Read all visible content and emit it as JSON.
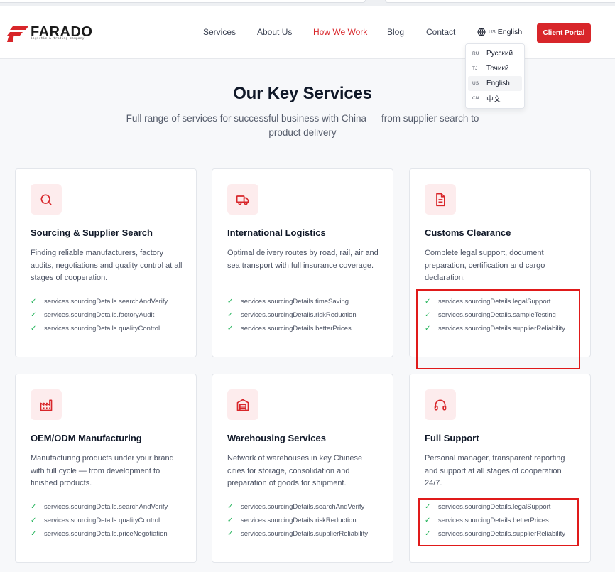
{
  "brand": {
    "name": "FARADO",
    "tagline": "logistic & trading company",
    "accent": "#d8262a"
  },
  "nav": {
    "items": [
      {
        "label": "Services",
        "active": false
      },
      {
        "label": "About Us",
        "active": false
      },
      {
        "label": "How We Work",
        "active": true
      },
      {
        "label": "Blog",
        "active": false
      },
      {
        "label": "Contact",
        "active": false
      }
    ],
    "language": {
      "code": "US",
      "label": "English",
      "icon": "globe-icon"
    },
    "portal_label": "Client Portal"
  },
  "language_menu": [
    {
      "code": "RU",
      "label": "Русский",
      "selected": false
    },
    {
      "code": "TJ",
      "label": "Точикӣ",
      "selected": false
    },
    {
      "code": "US",
      "label": "English",
      "selected": true
    },
    {
      "code": "CN",
      "label": "中文",
      "selected": false
    }
  ],
  "hero": {
    "title": "Our Key Services",
    "subtitle": "Full range of services for successful business with China — from supplier search to product delivery"
  },
  "services": [
    {
      "icon": "search-icon",
      "title": "Sourcing & Supplier Search",
      "description": "Finding reliable manufacturers, factory audits, negotiations and quality control at all stages of cooperation.",
      "features": [
        "services.sourcingDetails.searchAndVerify",
        "services.sourcingDetails.factoryAudit",
        "services.sourcingDetails.qualityControl"
      ]
    },
    {
      "icon": "truck-icon",
      "title": "International Logistics",
      "description": "Optimal delivery routes by road, rail, air and sea transport with full insurance coverage.",
      "features": [
        "services.sourcingDetails.timeSaving",
        "services.sourcingDetails.riskReduction",
        "services.sourcingDetails.betterPrices"
      ]
    },
    {
      "icon": "document-icon",
      "title": "Customs Clearance",
      "description": "Complete legal support, document preparation, certification and cargo declaration.",
      "features": [
        "services.sourcingDetails.legalSupport",
        "services.sourcingDetails.sampleTesting",
        "services.sourcingDetails.supplierReliability"
      ]
    },
    {
      "icon": "factory-icon",
      "title": "OEM/ODM Manufacturing",
      "description": "Manufacturing products under your brand with full cycle — from development to finished products.",
      "features": [
        "services.sourcingDetails.searchAndVerify",
        "services.sourcingDetails.qualityControl",
        "services.sourcingDetails.priceNegotiation"
      ]
    },
    {
      "icon": "warehouse-icon",
      "title": "Warehousing Services",
      "description": "Network of warehouses in key Chinese cities for storage, consolidation and preparation of goods for shipment.",
      "features": [
        "services.sourcingDetails.searchAndVerify",
        "services.sourcingDetails.riskReduction",
        "services.sourcingDetails.supplierReliability"
      ]
    },
    {
      "icon": "headphones-icon",
      "title": "Full Support",
      "description": "Personal manager, transparent reporting and support at all stages of cooperation 24/7.",
      "features": [
        "services.sourcingDetails.legalSupport",
        "services.sourcingDetails.betterPrices",
        "services.sourcingDetails.supplierReliability"
      ]
    }
  ],
  "check_icon": "check-icon",
  "highlight_color": "#e01a1a"
}
